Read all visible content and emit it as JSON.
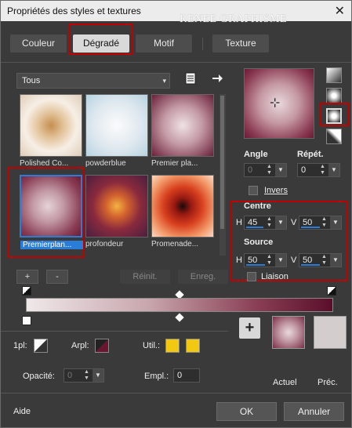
{
  "window": {
    "title": "Propriétés des styles et textures",
    "watermark": "RENEE GRAPHISME",
    "close_icon": "close-icon"
  },
  "tabs": [
    {
      "label": "Couleur"
    },
    {
      "label": "Dégradé",
      "active": true
    },
    {
      "label": "Motif"
    },
    {
      "label": "Texture"
    }
  ],
  "category_select": {
    "value": "Tous"
  },
  "thumbnails": [
    {
      "label": "Polished Co..."
    },
    {
      "label": "powderblue"
    },
    {
      "label": "Premier pla..."
    },
    {
      "label": "Premierplan...",
      "selected": true
    },
    {
      "label": "profondeur"
    },
    {
      "label": "Promenade..."
    }
  ],
  "list_buttons": {
    "add": "+",
    "remove": "-",
    "reset": "Réinit.",
    "save": "Enreg."
  },
  "angle": {
    "label": "Angle",
    "value": "0"
  },
  "repeat": {
    "label": "Répét.",
    "value": "0"
  },
  "invert": {
    "label": "Invers"
  },
  "centre": {
    "label": "Centre",
    "h_label": "H",
    "h": "45",
    "v_label": "V",
    "v": "50"
  },
  "source": {
    "label": "Source",
    "h_label": "H",
    "h": "50",
    "v_label": "V",
    "v": "50"
  },
  "link": {
    "label": "Liaison"
  },
  "bottom": {
    "opacity_1pl": "1pl:",
    "arpl": "Arpl:",
    "util": "Util.:",
    "opacity": {
      "label": "Opacité:",
      "value": "0"
    },
    "empl": {
      "label": "Empl.:",
      "value": "0"
    },
    "current_label": "Actuel",
    "previous_label": "Préc.",
    "add_button": "+"
  },
  "footer": {
    "help": "Aide",
    "ok": "OK",
    "cancel": "Annuler"
  },
  "colors": {
    "accent_blue": "#2a7dd6",
    "highlight_red": "#c00000",
    "swatch_yellow": "#f2c811",
    "gradient_dark": "#5a0e2a"
  }
}
